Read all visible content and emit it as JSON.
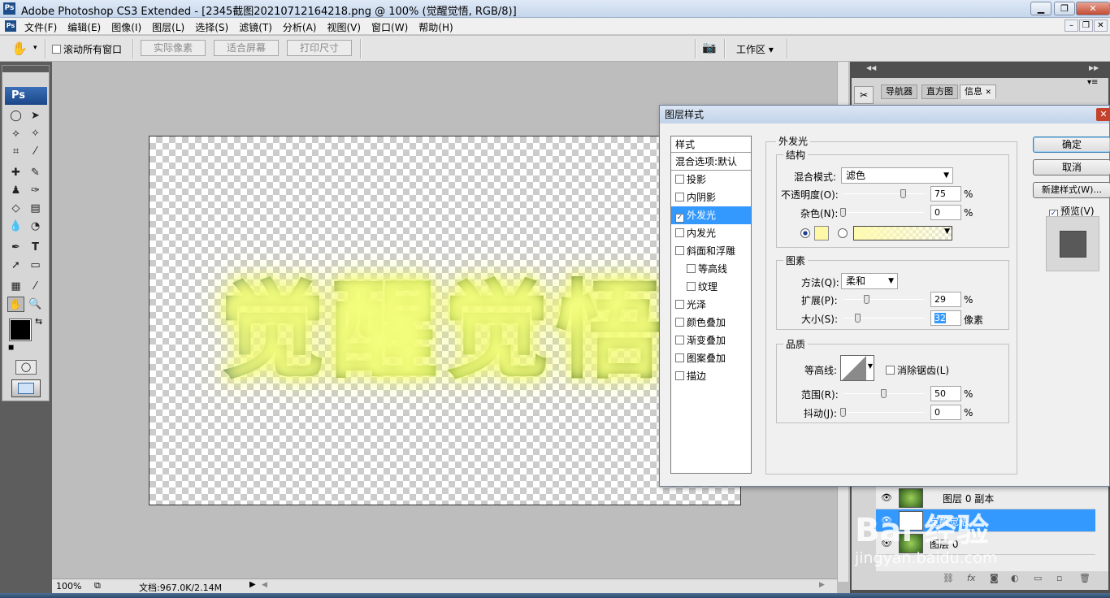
{
  "window": {
    "title": "Adobe Photoshop CS3 Extended - [2345截图20210712164218.png @ 100% (觉醒觉悟, RGB/8)]",
    "ps_logo": "Ps"
  },
  "menu": [
    "文件(F)",
    "编辑(E)",
    "图像(I)",
    "图层(L)",
    "选择(S)",
    "滤镜(T)",
    "分析(A)",
    "视图(V)",
    "窗口(W)",
    "帮助(H)"
  ],
  "options_bar": {
    "scroll_all": "滚动所有窗口",
    "actual_pixels": "实际像素",
    "fit_screen": "适合屏幕",
    "print_size": "打印尺寸",
    "workspace": "工作区 ▾"
  },
  "toolbox": {
    "logo": "Ps"
  },
  "canvas": {
    "text": "觉醒觉悟"
  },
  "status": {
    "zoom": "100%",
    "doc": "文档:967.0K/2.14M"
  },
  "panel_tabs": [
    "导航器",
    "直方图",
    "信息"
  ],
  "dialog": {
    "title": "图层样式",
    "list_header": "样式",
    "blend_default": "混合选项:默认",
    "styles": [
      {
        "label": "投影",
        "checked": false,
        "indent": false
      },
      {
        "label": "内阴影",
        "checked": false,
        "indent": false
      },
      {
        "label": "外发光",
        "checked": true,
        "indent": false,
        "selected": true
      },
      {
        "label": "内发光",
        "checked": false,
        "indent": false
      },
      {
        "label": "斜面和浮雕",
        "checked": false,
        "indent": false
      },
      {
        "label": "等高线",
        "checked": false,
        "indent": true
      },
      {
        "label": "纹理",
        "checked": false,
        "indent": true
      },
      {
        "label": "光泽",
        "checked": false,
        "indent": false
      },
      {
        "label": "颜色叠加",
        "checked": false,
        "indent": false
      },
      {
        "label": "渐变叠加",
        "checked": false,
        "indent": false
      },
      {
        "label": "图案叠加",
        "checked": false,
        "indent": false
      },
      {
        "label": "描边",
        "checked": false,
        "indent": false
      }
    ],
    "section_title": "外发光",
    "structure": {
      "title": "结构",
      "blend_mode_label": "混合模式:",
      "blend_mode": "滤色",
      "opacity_label": "不透明度(O):",
      "opacity": "75",
      "noise_label": "杂色(N):",
      "noise": "0",
      "percent": "%",
      "glow_color": "#fff7a8"
    },
    "elements": {
      "title": "图素",
      "method_label": "方法(Q):",
      "method": "柔和",
      "spread_label": "扩展(P):",
      "spread": "29",
      "size_label": "大小(S):",
      "size": "32",
      "percent": "%",
      "px_unit": "像素"
    },
    "quality": {
      "title": "品质",
      "contour_label": "等高线:",
      "antialias_label": "消除锯齿(L)",
      "range_label": "范围(R):",
      "range": "50",
      "jitter_label": "抖动(J):",
      "jitter": "0",
      "percent": "%"
    },
    "buttons": {
      "ok": "确定",
      "cancel": "取消",
      "new_style": "新建样式(W)...",
      "preview": "预览(V)"
    }
  },
  "layers": [
    {
      "name": "图层 0 副本",
      "selected": false
    },
    {
      "name": "觉醒觉悟",
      "selected": true
    },
    {
      "name": "图层 0",
      "selected": false
    }
  ],
  "watermark": {
    "line1": "Bai 经验",
    "line2": "jingyan.baidu.com"
  }
}
